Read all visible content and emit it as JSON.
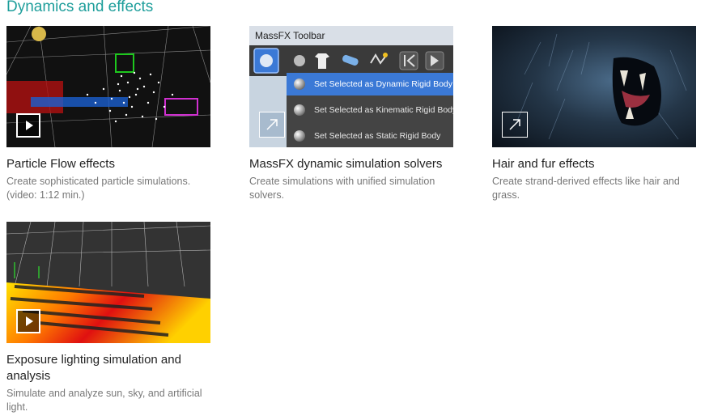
{
  "section": {
    "title": "Dynamics and effects"
  },
  "cards": [
    {
      "title": "Particle Flow effects",
      "desc": "Create sophisticated particle simulations. (video: 1:12 min.)",
      "action_icon": "play-icon"
    },
    {
      "title": "MassFX dynamic simulation solvers",
      "desc": "Create simulations with unified simulation solvers.",
      "action_icon": "external-link-icon",
      "thumb": {
        "toolbar_title": "MassFX Toolbar",
        "menu_items": [
          "Set Selected as Dynamic Rigid Body",
          "Set Selected as Kinematic Rigid Body",
          "Set Selected as Static Rigid Body"
        ]
      }
    },
    {
      "title": "Hair and fur effects",
      "desc": "Create strand-derived effects like hair and grass.",
      "action_icon": "external-link-icon"
    },
    {
      "title": "Exposure lighting simulation and analysis",
      "desc": "Simulate and analyze sun, sky, and artificial light.",
      "action_icon": "play-icon"
    }
  ],
  "colors": {
    "accent": "#1e9e9b",
    "menu_selected": "#3b79d6"
  }
}
